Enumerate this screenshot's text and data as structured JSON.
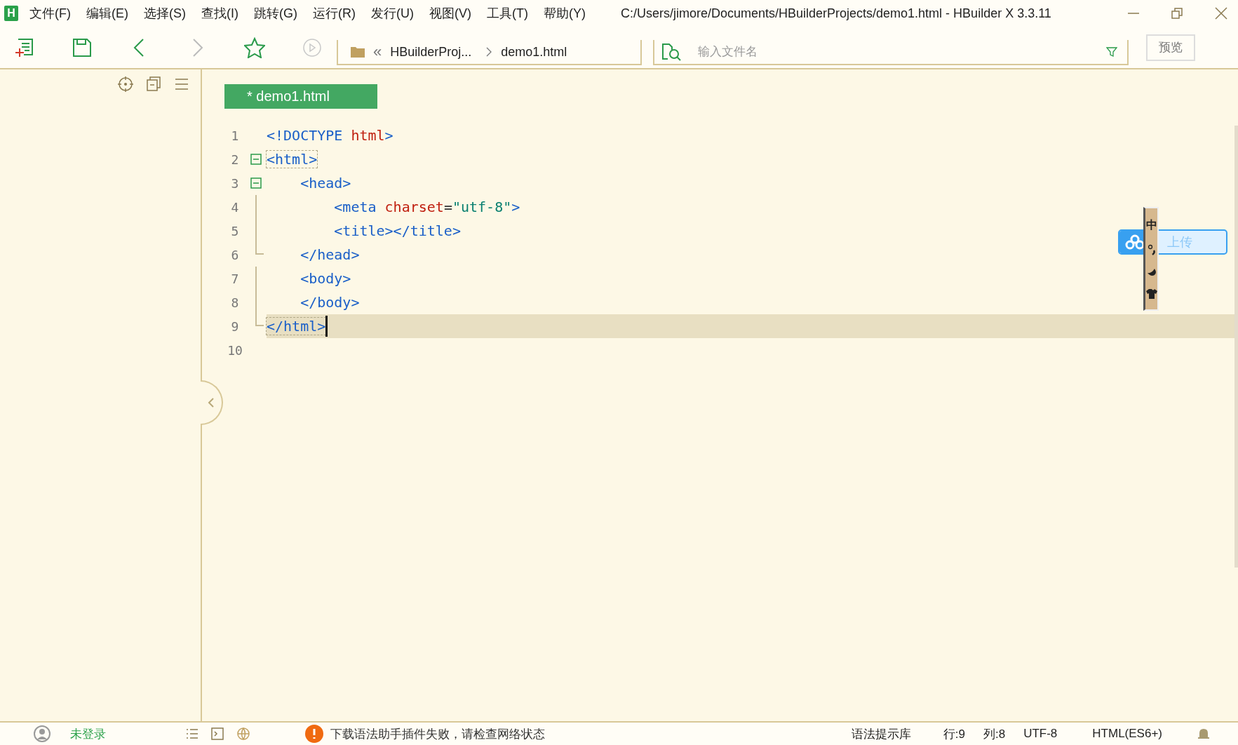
{
  "window": {
    "title": "C:/Users/jimore/Documents/HBuilderProjects/demo1.html - HBuilder X 3.3.11",
    "logo": "H"
  },
  "menu": [
    "文件(F)",
    "编辑(E)",
    "选择(S)",
    "查找(I)",
    "跳转(G)",
    "运行(R)",
    "发行(U)",
    "视图(V)",
    "工具(T)",
    "帮助(Y)"
  ],
  "breadcrumb": {
    "back": "«",
    "items": [
      "HBuilderProj...",
      "demo1.html"
    ]
  },
  "file_search": {
    "placeholder": "输入文件名"
  },
  "preview_button": "预览",
  "tabs": [
    {
      "label": "* demo1.html",
      "selected": true
    }
  ],
  "editor": {
    "lines": [
      {
        "number": "1",
        "kind": "plain",
        "current": false,
        "tokens": [
          {
            "kind": "tag",
            "text": "<!DOCTYPE "
          },
          {
            "kind": "name",
            "text": "html"
          },
          {
            "kind": "tag",
            "text": ">"
          }
        ]
      },
      {
        "number": "2",
        "kind": "fold-start",
        "current": false,
        "tokens": [
          {
            "kind": "match",
            "text": "<html>"
          }
        ]
      },
      {
        "number": "3",
        "kind": "fold-start",
        "current": false,
        "tokens": [
          {
            "kind": "tag",
            "text": "    <head>"
          }
        ]
      },
      {
        "number": "4",
        "kind": "fold-body",
        "current": false,
        "tokens": [
          {
            "kind": "tag",
            "text": "        <meta "
          },
          {
            "kind": "name",
            "text": "charset"
          },
          {
            "kind": "plain",
            "text": "="
          },
          {
            "kind": "value",
            "text": "\"utf-8\""
          },
          {
            "kind": "tag",
            "text": ">"
          }
        ]
      },
      {
        "number": "5",
        "kind": "fold-body",
        "current": false,
        "tokens": [
          {
            "kind": "tag",
            "text": "        <title></title>"
          }
        ]
      },
      {
        "number": "6",
        "kind": "fold-end",
        "current": false,
        "tokens": [
          {
            "kind": "tag",
            "text": "    </head>"
          }
        ]
      },
      {
        "number": "7",
        "kind": "fold-body",
        "current": false,
        "tokens": [
          {
            "kind": "tag",
            "text": "    <body>"
          }
        ]
      },
      {
        "number": "8",
        "kind": "fold-body",
        "current": false,
        "tokens": [
          {
            "kind": "tag",
            "text": "    </body>"
          }
        ]
      },
      {
        "number": "9",
        "kind": "fold-end",
        "current": true,
        "tokens": [
          {
            "kind": "match",
            "text": "</html>"
          }
        ]
      },
      {
        "number": "10",
        "kind": "plain",
        "current": false
      }
    ]
  },
  "upload_widget": {
    "label": "上传"
  },
  "ime_bar": {
    "mode": "中"
  },
  "status_bar": {
    "user": "未登录",
    "message": "下载语法助手插件失败，请检查网络状态",
    "library": "语法提示库",
    "row": "行:9",
    "column": "列:8",
    "encoding": "UTF-8",
    "language": "HTML(ES6+)"
  }
}
